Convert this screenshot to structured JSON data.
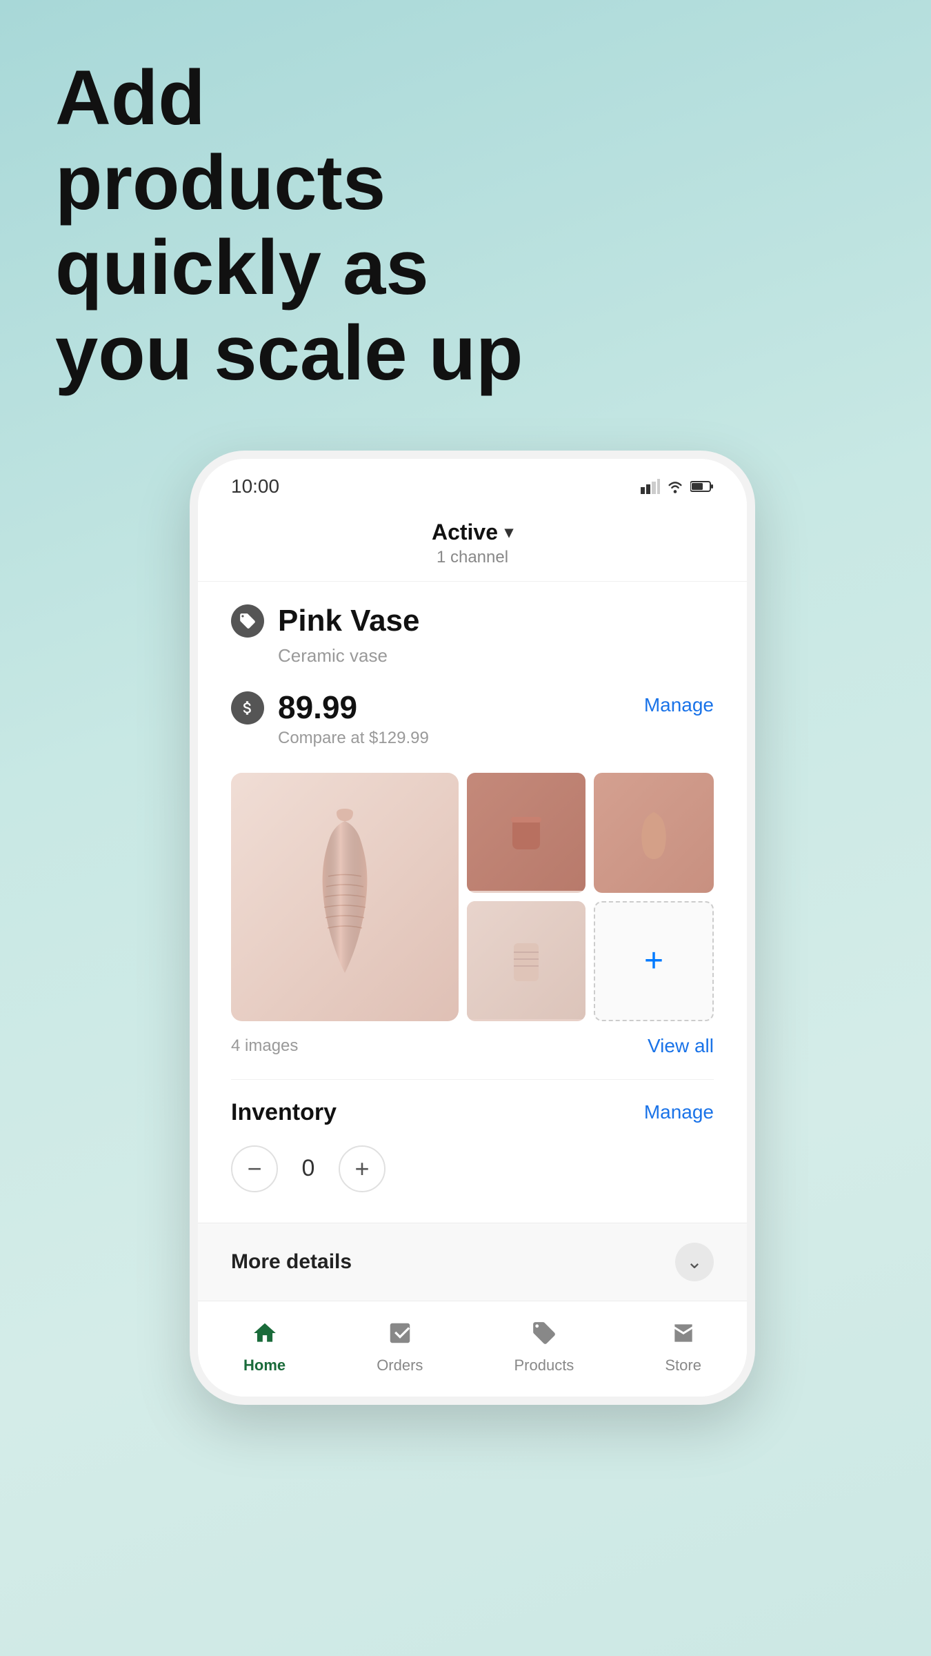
{
  "headline": "Add products quickly as you scale up",
  "phone": {
    "status": {
      "time": "10:00"
    },
    "active_bar": {
      "title": "Active",
      "subtitle": "1 channel"
    },
    "product": {
      "name": "Pink Vase",
      "description": "Ceramic vase",
      "price": "89.99",
      "compare_at": "Compare at $129.99",
      "manage_label": "Manage",
      "images_count": "4 images",
      "view_all_label": "View all"
    },
    "inventory": {
      "title": "Inventory",
      "manage_label": "Manage",
      "quantity": "0",
      "minus_label": "−",
      "plus_label": "+"
    },
    "more_details": {
      "label": "More details"
    },
    "nav": {
      "home": "Home",
      "orders": "Orders",
      "products": "Products",
      "store": "Store"
    }
  }
}
